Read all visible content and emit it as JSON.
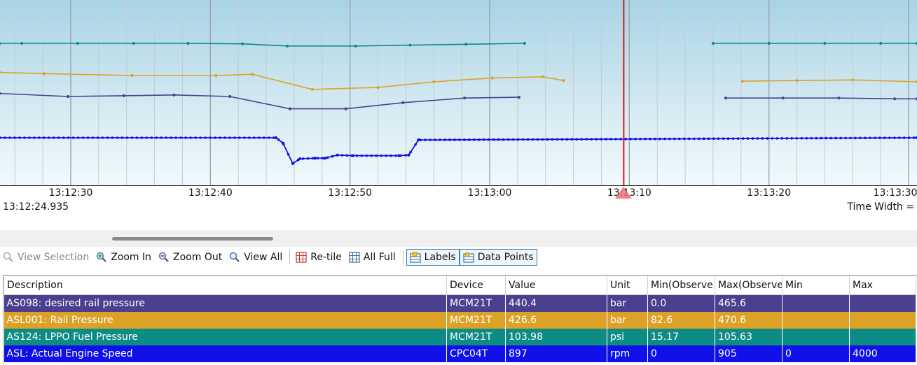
{
  "time_axis": {
    "ticks": [
      "13:12:30",
      "13:12:40",
      "13:12:50",
      "13:13:00",
      "13:13:10",
      "13:13:20",
      "13:13:30"
    ],
    "start_time": "13:12:24.935",
    "time_width_label": "Time Width ="
  },
  "toolbar": {
    "view_selection": "View Selection",
    "zoom_in": "Zoom In",
    "zoom_out": "Zoom Out",
    "view_all": "View All",
    "retile": "Re-tile",
    "all_full": "All Full",
    "labels": "Labels",
    "data_points": "Data Points"
  },
  "table": {
    "headers": [
      "Description",
      "Device",
      "Value",
      "Unit",
      "Min(Observe",
      "Max(Observe",
      "Min",
      "Max"
    ],
    "rows": [
      {
        "description": "AS098: desired rail pressure",
        "device": "MCM21T",
        "value": "440.4",
        "unit": "bar",
        "min_obs": "0.0",
        "max_obs": "465.6",
        "min": "",
        "max": "",
        "color": "#4b3f8f"
      },
      {
        "description": "ASL001: Rail Pressure",
        "device": "MCM21T",
        "value": "426.6",
        "unit": "bar",
        "min_obs": "82.6",
        "max_obs": "470.6",
        "min": "",
        "max": "",
        "color": "#dba227"
      },
      {
        "description": "AS124: LPPO Fuel Pressure",
        "device": "MCM21T",
        "value": "103.98",
        "unit": "psi",
        "min_obs": "15.17",
        "max_obs": "105.63",
        "min": "",
        "max": "",
        "color": "#0d8c86"
      },
      {
        "description": "ASL: Actual Engine Speed",
        "device": "CPC04T",
        "value": "897",
        "unit": "rpm",
        "min_obs": "0",
        "max_obs": "905",
        "min": "0",
        "max": "4000",
        "color": "#1010e8"
      }
    ]
  },
  "colors": {
    "cursor": "#e01010",
    "series_purple": "#4b3f8f",
    "series_orange": "#dba227",
    "series_teal": "#0d8c86",
    "series_blue": "#1010e8"
  },
  "cursor_time": "13:13:09.6",
  "chart_data": {
    "type": "line",
    "x_unit": "time (s after 13:12:24.935)",
    "xlim": [
      "13:12:24.935",
      "13:13:30.6"
    ],
    "series": [
      {
        "name": "AS124: LPPO Fuel Pressure",
        "color": "#0d8c86",
        "x": [
          "13:12:24.9",
          "13:12:26.5",
          "13:12:30.5",
          "13:12:34.5",
          "13:12:38.4",
          "13:12:42.3",
          "13:12:45.5",
          "13:12:50.4",
          "13:12:54.3",
          "13:12:58.3",
          "13:13:02.5"
        ],
        "y": [
          104.6,
          104.6,
          104.6,
          104.6,
          104.6,
          104.5,
          104.0,
          104.0,
          104.2,
          104.4,
          104.6
        ]
      },
      {
        "name": "AS124: LPPO Fuel Pressure (after gap)",
        "color": "#0d8c86",
        "x": [
          "13:13:16.0",
          "13:13:20.0",
          "13:13:24.0",
          "13:13:28.0",
          "13:13:30.6"
        ],
        "y": [
          104.6,
          104.6,
          104.6,
          104.6,
          104.6
        ]
      },
      {
        "name": "ASL001: Rail Pressure",
        "color": "#dba227",
        "x": [
          "13:12:24.9",
          "13:12:28.1",
          "13:12:34.4",
          "13:12:40.4",
          "13:12:43.0",
          "13:12:47.3",
          "13:12:52.0",
          "13:12:56.0",
          "13:13:00.2",
          "13:13:03.8",
          "13:13:05.3"
        ],
        "y": [
          465,
          463,
          460,
          460,
          462,
          438,
          441,
          450,
          456,
          458,
          452
        ]
      },
      {
        "name": "ASL001: Rail Pressure (after gap)",
        "color": "#dba227",
        "x": [
          "13:13:18.1",
          "13:13:22.0",
          "13:13:26.0",
          "13:13:30.6"
        ],
        "y": [
          451,
          452,
          453,
          450
        ]
      },
      {
        "name": "AS098: desired rail pressure",
        "color": "#4b3f8f",
        "x": [
          "13:12:24.9",
          "13:12:29.8",
          "13:12:33.8",
          "13:12:37.4",
          "13:12:41.4",
          "13:12:45.7",
          "13:12:49.7",
          "13:12:53.8",
          "13:12:58.2",
          "13:13:02.1"
        ],
        "y": [
          440,
          436,
          437,
          438,
          436,
          420,
          420,
          428,
          434,
          435
        ]
      },
      {
        "name": "AS098: desired rail pressure (after gap)",
        "color": "#4b3f8f",
        "x": [
          "13:13:16.9",
          "13:13:21.0",
          "13:13:25.0",
          "13:13:29.0",
          "13:13:30.6"
        ],
        "y": [
          434,
          434,
          434,
          433,
          433
        ]
      },
      {
        "name": "ASL: Actual Engine Speed",
        "color": "#1010e8",
        "x": [
          "13:12:24.9",
          "13:12:44.7",
          "13:12:45.2",
          "13:12:45.9",
          "13:12:46.4",
          "13:12:47.5",
          "13:12:48.2",
          "13:12:49.1",
          "13:12:50.2",
          "13:12:53.5",
          "13:12:54.2",
          "13:12:54.9",
          "13:13:30.6"
        ],
        "y": [
          897,
          897,
          880,
          815,
          830,
          832,
          832,
          842,
          840,
          840,
          842,
          890,
          897
        ]
      }
    ]
  }
}
